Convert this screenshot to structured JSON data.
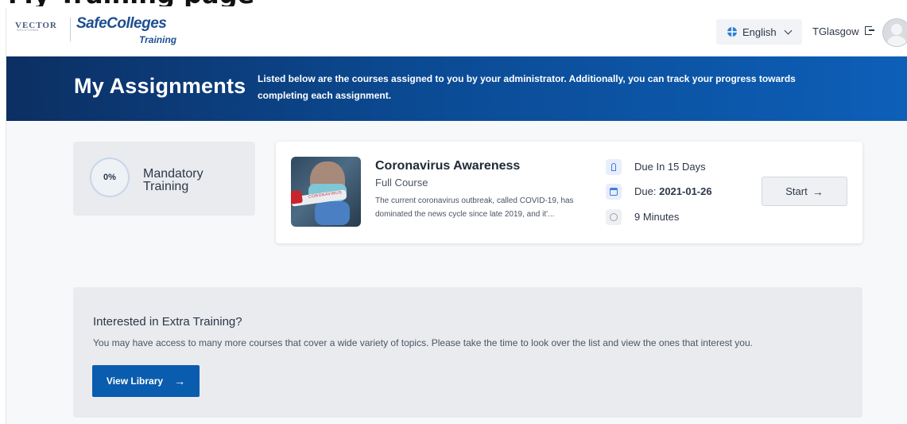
{
  "page_heading_fragment": "My Training page",
  "brand": {
    "vector_logo_text": "VECTOR",
    "vector_logo_sub": "SOLUTIONS",
    "logo_main": "SafeColleges",
    "logo_sub": "Training"
  },
  "header": {
    "language_label": "English",
    "username": "TGlasgow"
  },
  "hero": {
    "title": "My Assignments",
    "description": "Listed below are the courses assigned to you by your administrator. Additionally, you can track your progress towards completing each assignment."
  },
  "progress": {
    "percent_label": "0%",
    "label": "Mandatory Training"
  },
  "course": {
    "title": "Coronavirus Awareness",
    "type": "Full Course",
    "description": "The current coronavirus outbreak, called COVID-19, has dominated the news cycle since late 2019, and it'...",
    "thumbnail_label": "CORONAVIRUS",
    "due_in": "Due In 15 Days",
    "due_label": "Due:",
    "due_date": "2021-01-26",
    "duration": "9 Minutes",
    "start_label": "Start",
    "start_arrow": "→"
  },
  "extra": {
    "title": "Interested in Extra Training?",
    "description": "You may have access to many more courses that cover a wide variety of topics. Please take the time to look over the list and view the ones that interest you.",
    "button_label": "View Library",
    "button_arrow": "→"
  },
  "colors": {
    "hero_start": "#0c2f63",
    "hero_end": "#0d5fb8",
    "brand_blue": "#1d4f91",
    "button_blue": "#0a5cae",
    "accent_blue": "#3b7de0"
  }
}
